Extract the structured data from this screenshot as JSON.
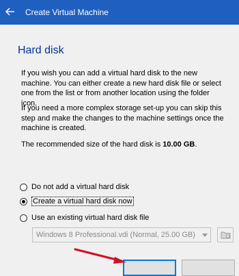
{
  "window": {
    "title": "Create Virtual Machine"
  },
  "page": {
    "heading": "Hard disk",
    "paragraph1": "If you wish you can add a virtual hard disk to the new machine. You can either create a new hard disk file or select one from the list or from another location using the folder icon.",
    "paragraph2": "If you need a more complex storage set-up you can skip this step and make the changes to the machine settings once the machine is created.",
    "recommended_prefix": "The recommended size of the hard disk is ",
    "recommended_size": "10.00 GB",
    "recommended_suffix": "."
  },
  "options": [
    {
      "label": "Do not add a virtual hard disk",
      "checked": false
    },
    {
      "label": "Create a virtual hard disk now",
      "checked": true
    },
    {
      "label": "Use an existing virtual hard disk file",
      "checked": false
    }
  ],
  "existing_disk": {
    "selected": "Windows 8 Professional.vdi (Normal, 25.00 GB)"
  },
  "colors": {
    "titlebar": "#1f5fbf",
    "heading": "#003399",
    "annotation_arrow": "#d0102a"
  }
}
